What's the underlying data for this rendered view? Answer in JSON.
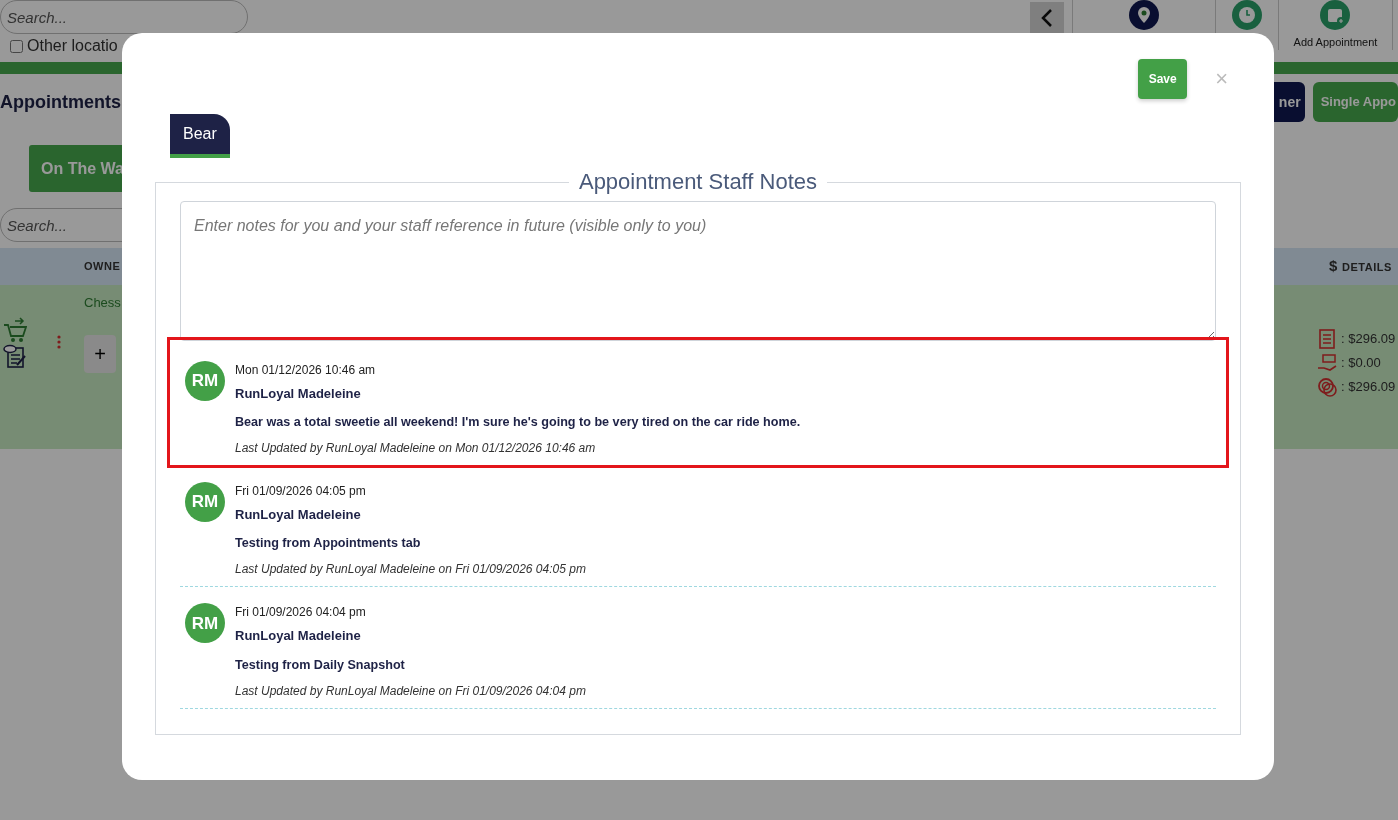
{
  "background": {
    "top_search": {
      "placeholder": "Search..."
    },
    "other_location": {
      "label": "Other locatio",
      "checked": false
    },
    "toolbar": [
      {
        "kind": "back"
      },
      {
        "kind": "pin"
      },
      {
        "kind": "clock"
      },
      {
        "kind": "add",
        "label": "Add Appointment"
      }
    ],
    "title": "Appointments",
    "buttons": [
      {
        "kind": "navy",
        "label": "ner"
      },
      {
        "kind": "green",
        "label": "Single Appo"
      }
    ],
    "status_tab": "On The Wa",
    "search": {
      "placeholder": "Search..."
    },
    "table": {
      "columns": [
        {
          "label": "OWNE"
        },
        {
          "icon": "$",
          "label": "DETAILS"
        }
      ],
      "row": {
        "owner": "Chess",
        "add": "+",
        "amounts": [
          {
            "kind": "invoice",
            "value": ": $296.09"
          },
          {
            "kind": "payment",
            "value": ": $0.00"
          },
          {
            "kind": "balance",
            "value": ": $296.09"
          }
        ]
      }
    }
  },
  "modal": {
    "save": "Save",
    "close": "×",
    "tabs": [
      {
        "label": "Bear",
        "selected": true
      }
    ],
    "legend": "Appointment Staff Notes",
    "notes_field": {
      "placeholder": "Enter notes for you and your staff reference in future (visible only to you)"
    },
    "notes": [
      {
        "initials": "RM",
        "date": "Mon 01/12/2026 10:46 am",
        "author": "RunLoyal Madeleine",
        "text": "Bear was a total sweetie all weekend! I'm sure he's going to be very tired on the car ride home.",
        "updated": "Last Updated by RunLoyal Madeleine on Mon 01/12/2026 10:46 am",
        "highlighted": true
      },
      {
        "initials": "RM",
        "date": "Fri 01/09/2026 04:05 pm",
        "author": "RunLoyal Madeleine",
        "text": "Testing from Appointments tab",
        "updated": "Last Updated by RunLoyal Madeleine on Fri 01/09/2026 04:05 pm",
        "highlighted": false
      },
      {
        "initials": "RM",
        "date": "Fri 01/09/2026 04:04 pm",
        "author": "RunLoyal Madeleine",
        "text": "Testing from Daily Snapshot",
        "updated": "Last Updated by RunLoyal Madeleine on Fri 01/09/2026 04:04 pm",
        "highlighted": false
      }
    ]
  }
}
